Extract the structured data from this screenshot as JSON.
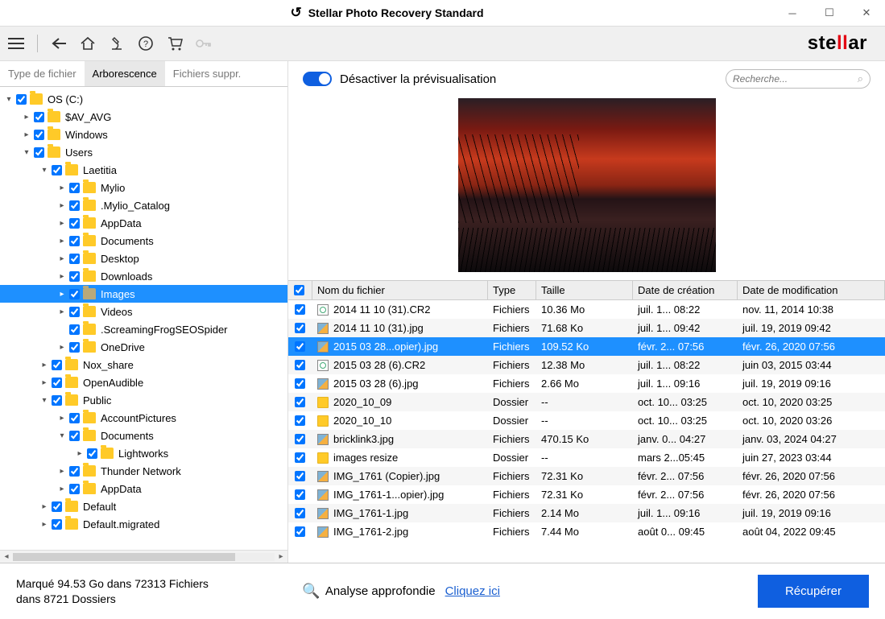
{
  "titlebar": {
    "title": "Stellar Photo Recovery Standard"
  },
  "brand": {
    "pre": "ste",
    "mid": "ll",
    "post": "ar"
  },
  "tabs": {
    "t0": "Type de fichier",
    "t1": "Arborescence",
    "t2": "Fichiers suppr."
  },
  "tree": [
    {
      "d": 0,
      "tw": "▾",
      "label": "OS (C:)"
    },
    {
      "d": 1,
      "tw": "▸",
      "label": "$AV_AVG"
    },
    {
      "d": 1,
      "tw": "▸",
      "label": "Windows"
    },
    {
      "d": 1,
      "tw": "▾",
      "label": "Users"
    },
    {
      "d": 2,
      "tw": "▾",
      "label": "Laetitia"
    },
    {
      "d": 3,
      "tw": "▸",
      "label": "Mylio"
    },
    {
      "d": 3,
      "tw": "▸",
      "label": ".Mylio_Catalog"
    },
    {
      "d": 3,
      "tw": "▸",
      "label": "AppData"
    },
    {
      "d": 3,
      "tw": "▸",
      "label": "Documents"
    },
    {
      "d": 3,
      "tw": "▸",
      "label": "Desktop"
    },
    {
      "d": 3,
      "tw": "▸",
      "label": "Downloads"
    },
    {
      "d": 3,
      "tw": "▸",
      "label": "Images",
      "sel": true,
      "dim": true
    },
    {
      "d": 3,
      "tw": "▸",
      "label": "Videos"
    },
    {
      "d": 3,
      "tw": "",
      "label": ".ScreamingFrogSEOSpider"
    },
    {
      "d": 3,
      "tw": "▸",
      "label": "OneDrive"
    },
    {
      "d": 2,
      "tw": "▸",
      "label": "Nox_share"
    },
    {
      "d": 2,
      "tw": "▸",
      "label": "OpenAudible"
    },
    {
      "d": 2,
      "tw": "▾",
      "label": "Public"
    },
    {
      "d": 3,
      "tw": "▸",
      "label": "AccountPictures"
    },
    {
      "d": 3,
      "tw": "▾",
      "label": "Documents"
    },
    {
      "d": 4,
      "tw": "▸",
      "label": "Lightworks"
    },
    {
      "d": 3,
      "tw": "▸",
      "label": "Thunder Network"
    },
    {
      "d": 3,
      "tw": "▸",
      "label": "AppData"
    },
    {
      "d": 2,
      "tw": "▸",
      "label": "Default"
    },
    {
      "d": 2,
      "tw": "▸",
      "label": "Default.migrated"
    }
  ],
  "preview": {
    "toggle_label": "Désactiver la prévisualisation"
  },
  "search": {
    "placeholder": "Recherche..."
  },
  "columns": {
    "name": "Nom du fichier",
    "type": "Type",
    "size": "Taille",
    "created": "Date de création",
    "modified": "Date de modification"
  },
  "rows": [
    {
      "ico": "cr2",
      "name": "2014 11 10 (31).CR2",
      "type": "Fichiers",
      "size": "10.36 Mo",
      "created": "juil. 1... 08:22",
      "modified": "nov. 11, 2014 10:38"
    },
    {
      "ico": "img",
      "name": "2014 11 10 (31).jpg",
      "type": "Fichiers",
      "size": "71.68 Ko",
      "created": "juil. 1... 09:42",
      "modified": "juil. 19, 2019 09:42"
    },
    {
      "ico": "img",
      "name": "2015 03 28...opier).jpg",
      "type": "Fichiers",
      "size": "109.52 Ko",
      "created": "févr. 2... 07:56",
      "modified": "févr. 26, 2020 07:56",
      "sel": true
    },
    {
      "ico": "cr2",
      "name": "2015 03 28 (6).CR2",
      "type": "Fichiers",
      "size": "12.38 Mo",
      "created": "juil. 1... 08:22",
      "modified": "juin 03, 2015 03:44"
    },
    {
      "ico": "img",
      "name": "2015 03 28 (6).jpg",
      "type": "Fichiers",
      "size": "2.66 Mo",
      "created": "juil. 1... 09:16",
      "modified": "juil. 19, 2019 09:16"
    },
    {
      "ico": "fold",
      "name": "2020_10_09",
      "type": "Dossier",
      "size": "--",
      "created": "oct. 10... 03:25",
      "modified": "oct. 10, 2020 03:25"
    },
    {
      "ico": "fold",
      "name": "2020_10_10",
      "type": "Dossier",
      "size": "--",
      "created": "oct. 10... 03:25",
      "modified": "oct. 10, 2020 03:26"
    },
    {
      "ico": "img",
      "name": "bricklink3.jpg",
      "type": "Fichiers",
      "size": "470.15 Ko",
      "created": "janv. 0... 04:27",
      "modified": "janv. 03, 2024 04:27"
    },
    {
      "ico": "fold",
      "name": "images resize",
      "type": "Dossier",
      "size": "--",
      "created": "mars 2...05:45",
      "modified": "juin 27, 2023 03:44"
    },
    {
      "ico": "img",
      "name": "IMG_1761 (Copier).jpg",
      "type": "Fichiers",
      "size": "72.31 Ko",
      "created": "févr. 2... 07:56",
      "modified": "févr. 26, 2020 07:56"
    },
    {
      "ico": "img",
      "name": "IMG_1761-1...opier).jpg",
      "type": "Fichiers",
      "size": "72.31 Ko",
      "created": "févr. 2... 07:56",
      "modified": "févr. 26, 2020 07:56"
    },
    {
      "ico": "img",
      "name": "IMG_1761-1.jpg",
      "type": "Fichiers",
      "size": "2.14 Mo",
      "created": "juil. 1... 09:16",
      "modified": "juil. 19, 2019 09:16"
    },
    {
      "ico": "img",
      "name": "IMG_1761-2.jpg",
      "type": "Fichiers",
      "size": "7.44 Mo",
      "created": "août 0... 09:45",
      "modified": "août 04, 2022 09:45"
    }
  ],
  "footer": {
    "status_l1": "Marqué 94.53 Go dans 72313 Fichiers",
    "status_l2": "dans 8721 Dossiers",
    "deep_label": "Analyse approfondie",
    "deep_link": "Cliquez ici",
    "recover": "Récupérer"
  }
}
